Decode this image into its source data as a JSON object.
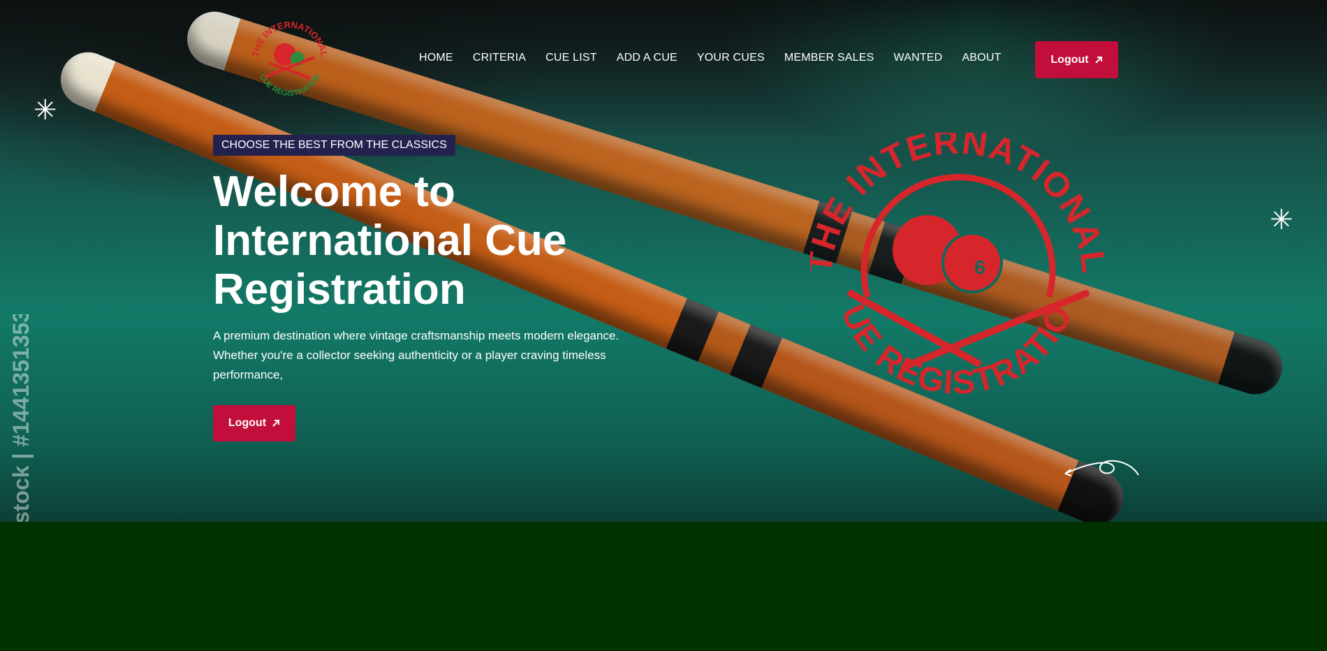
{
  "nav": {
    "items": [
      {
        "label": "HOME"
      },
      {
        "label": "CRITERIA"
      },
      {
        "label": "CUE LIST"
      },
      {
        "label": "ADD A CUE"
      },
      {
        "label": "YOUR CUES"
      },
      {
        "label": "MEMBER SALES"
      },
      {
        "label": "WANTED"
      },
      {
        "label": "ABOUT"
      }
    ]
  },
  "header": {
    "logout_label": "Logout",
    "logout_icon": "arrow-up-right-icon",
    "logo_text": "THE INTERNATIONAL CUE REGISTRATION"
  },
  "hero": {
    "tag": "CHOOSE THE BEST FROM THE CLASSICS",
    "title_line1": "Welcome to",
    "title_line2": "International Cue",
    "title_line3": "Registration",
    "description_line1": "A premium destination where vintage craftsmanship meets modern elegance.",
    "description_line2": "Whether you're a collector seeking authenticity or a player craving timeless",
    "description_line3": "performance,",
    "button_label": "Logout",
    "logo_top_text": "THE INTERNATIONAL",
    "logo_bottom_text": "CUE REGISTRATION",
    "ball_number": "6",
    "watermark": "stock | #1441351353"
  },
  "colors": {
    "accent": "#c20e3a",
    "tag_bg": "#23224f",
    "logo_red": "#d7262b",
    "logo_green": "#2e8b3e",
    "footer_bg": "#003300"
  }
}
